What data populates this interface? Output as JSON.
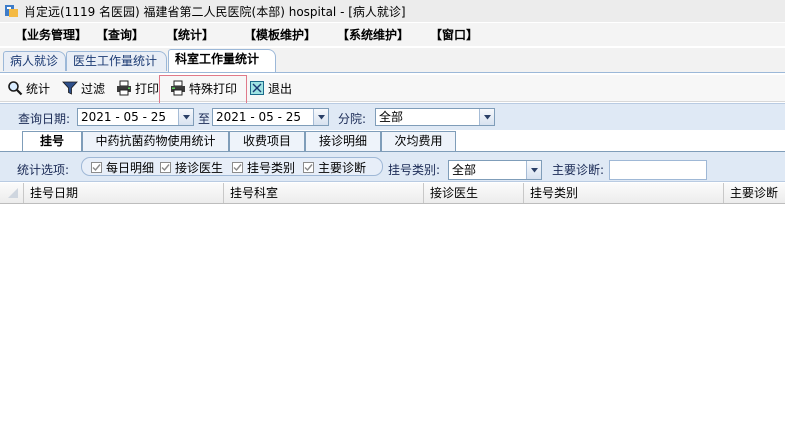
{
  "window": {
    "title": "肖定远(1119 名医园) 福建省第二人民医院(本部) hospital - [病人就诊]"
  },
  "menu": [
    "【业务管理】",
    "【查询】",
    "【统计】",
    "【模板维护】",
    "【系统维护】",
    "【窗口】"
  ],
  "top_tabs": [
    "病人就诊",
    "医生工作量统计",
    "科室工作量统计"
  ],
  "toolbar": {
    "stats": "统计",
    "filter": "过滤",
    "print": "打印",
    "special_print": "特殊打印",
    "exit": "退出"
  },
  "query": {
    "date_label": "查询日期:",
    "date_from": "2021 - 05 - 25",
    "to_label": "至",
    "date_to": "2021 - 05 - 25",
    "branch_label": "分院:",
    "branch_value": "全部"
  },
  "sub_tabs": [
    "挂号",
    "中药抗菌药物使用统计",
    "收费项目",
    "接诊明细",
    "次均费用"
  ],
  "options": {
    "label": "统计选项:",
    "checks": [
      "每日明细",
      "接诊医生",
      "挂号类别",
      "主要诊断"
    ],
    "reg_type_label": "挂号类别:",
    "reg_type_value": "全部",
    "diag_label": "主要诊断:"
  },
  "grid": {
    "columns": [
      "挂号日期",
      "挂号科室",
      "接诊医生",
      "挂号类别",
      "主要诊断"
    ]
  }
}
